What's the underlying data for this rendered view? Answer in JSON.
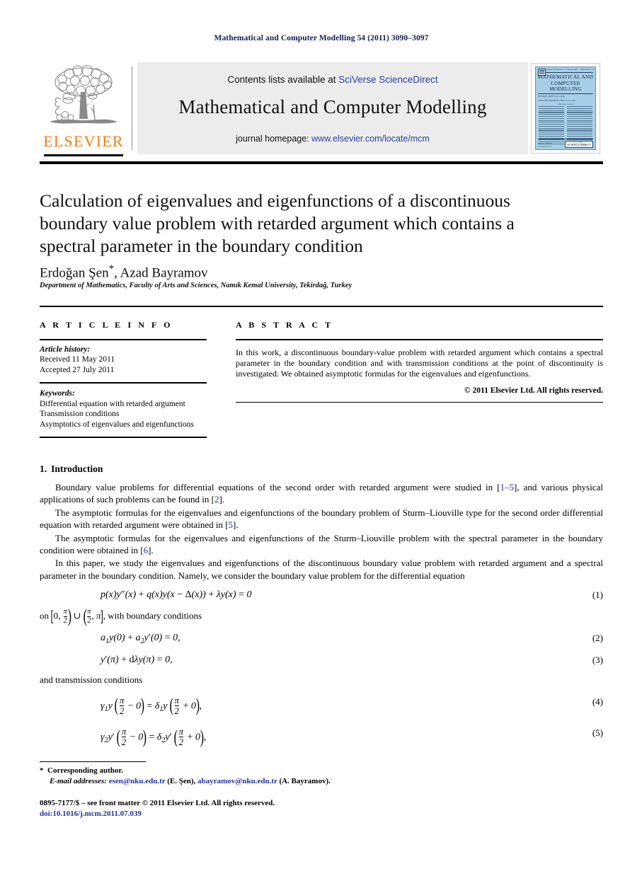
{
  "running_head": "Mathematical and Computer Modelling 54 (2011) 3090–3097",
  "masthead": {
    "publisher_wordmark": "ELSEVIER",
    "contents_prefix": "Contents lists available at ",
    "contents_link": "SciVerse ScienceDirect",
    "journal_title": "Mathematical and Computer Modelling",
    "homepage_prefix": "journal homepage: ",
    "homepage_link": "www.elsevier.com/locate/mcm",
    "cover": {
      "top_bar_left": "Volume 00 Number 0  1 January 0000",
      "top_bar_right": "ISSN 0895-7177",
      "title": "MATHEMATICAL AND COMPUTER MODELLING",
      "editors_line1": "EDITOR-IN-CHIEF: Ervin Y. Rodin",
      "editors_line2": "ASSOCIATE EDITORS-IN-CHIEF: X. J. R. Avula",
      "board_heading": "EDITORIAL BOARD",
      "publisher": "PERGAMON",
      "publisher_sub": "www.elsevier.com",
      "access_small": "Now available on",
      "access_big": "SCIENCE DIRECT"
    }
  },
  "article": {
    "title": "Calculation of eigenvalues and eigenfunctions of a discontinuous boundary value problem with retarded argument which contains a spectral parameter in the boundary condition",
    "authors": "Erdoğan Şen",
    "author_star": "*",
    "authors_rest": ", Azad Bayramov",
    "affiliation": "Department of Mathematics, Faculty of Arts and Sciences, Namık Kemal University, Tekirdağ, Turkey"
  },
  "article_info": {
    "heading": "A R T I C L E   I N F O",
    "history_label": "Article history:",
    "received": "Received 11 May 2011",
    "accepted": "Accepted 27 July 2011",
    "keywords_label": "Keywords:",
    "keywords": [
      "Differential equation with retarded argument",
      "Transmission conditions",
      "Asymptotics of eigenvalues and eigenfunctions"
    ]
  },
  "abstract": {
    "heading": "A B S T R A C T",
    "text": "In this work, a discontinuous boundary-value problem with retarded argument which contains a spectral parameter in the boundary condition and with transmission conditions at the point of discontinuity is investigated. We obtained asymptotic formulas for the eigenvalues and eigenfunctions.",
    "copyright": "© 2011 Elsevier Ltd. All rights reserved."
  },
  "sections": {
    "intro_number": "1.",
    "intro_title": "Introduction",
    "p1_a": "Boundary value problems for differential equations of the second order with retarded argument were studied in [",
    "p1_ref1": "1–5",
    "p1_b": "], and various physical applications of such problems can be found in [",
    "p1_ref2": "2",
    "p1_c": "].",
    "p2_a": "The asymptotic formulas for the eigenvalues and eigenfunctions of the boundary problem of Sturm–Liouville type for the second order differential equation with retarded argument were obtained in [",
    "p2_ref": "5",
    "p2_b": "].",
    "p3_a": "The asymptotic formulas for the eigenvalues and eigenfunctions of the Sturm–Liouville problem with the spectral parameter in the boundary condition were obtained in [",
    "p3_ref": "6",
    "p3_b": "].",
    "p4": "In this paper, we study the eigenvalues and eigenfunctions of the discontinuous boundary value problem with retarded argument and a spectral parameter in the boundary condition. Namely, we consider the boundary value problem for the differential equation",
    "domain_prefix": "on",
    "domain_suffix": ", with boundary conditions",
    "transmission_label": "and transmission conditions"
  },
  "equations": {
    "eq1_number": "(1)",
    "eq1_text": "p(x)y″(x) + q(x)y(x − Δ(x)) + λy(x) = 0",
    "eq2_number": "(2)",
    "eq2_text": "a₁y(0) + a₂y′(0) = 0,",
    "eq3_number": "(3)",
    "eq3_text": "y′(π) + dλy(π) = 0,",
    "eq4_number": "(4)",
    "eq4_text": "γ₁y(π/2 − 0) = δ₁y(π/2 + 0),",
    "eq5_number": "(5)",
    "eq5_text": "γ₂y′(π/2 − 0) = δ₂y′(π/2 + 0),",
    "domain_text": "[0, π/2) ∪ (π/2, π]"
  },
  "footnotes": {
    "corresponding": "Corresponding author.",
    "email_label": "E-mail addresses:",
    "email1": "esen@nku.edu.tr",
    "email1_person": "(E. Şen),",
    "email2": "abayramov@nku.edu.tr",
    "email2_person": "(A. Bayramov)."
  },
  "colophon": {
    "issn_line": "0895-7177/$ – see front matter © 2011 Elsevier Ltd. All rights reserved.",
    "doi": "doi:10.1016/j.mcm.2011.07.039"
  },
  "colors": {
    "link_blue": "#2431a3",
    "masthead_link": "#2a3ea0",
    "running_head": "#161b54",
    "elsevier_orange": "#f07f13",
    "journal_box_bg": "#ececec",
    "cover_blue": "#a9cfe8"
  }
}
